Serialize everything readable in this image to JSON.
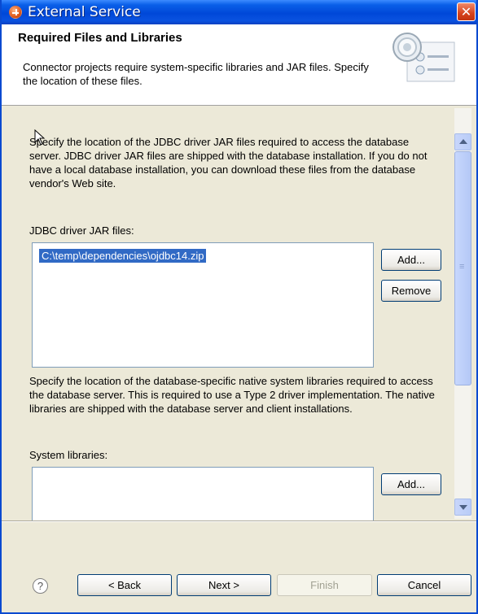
{
  "window": {
    "title": "External Service",
    "close_glyph": "✕"
  },
  "banner": {
    "heading": "Required Files and Libraries",
    "description": "Connector projects require system-specific libraries and JAR files. Specify the location of these files.",
    "icon": "settings-dialog-icon"
  },
  "jdbc": {
    "description": "Specify the location of the JDBC driver JAR files required to access the database server. JDBC driver JAR files are shipped with the database installation. If you do not have a local database installation, you can download these files from the database vendor's Web site.",
    "label": "JDBC driver JAR files:",
    "files": [
      "C:\\temp\\dependencies\\ojdbc14.zip"
    ],
    "add_label": "Add...",
    "remove_label": "Remove"
  },
  "system": {
    "description": "Specify the location of the database-specific native system libraries required to access the database server. This is required to use a Type 2 driver implementation. The native libraries are shipped with the database server and client installations.",
    "label": "System libraries:",
    "add_label": "Add..."
  },
  "footer": {
    "help_glyph": "?",
    "back_label": "< Back",
    "next_label": "Next >",
    "finish_label": "Finish",
    "cancel_label": "Cancel"
  }
}
